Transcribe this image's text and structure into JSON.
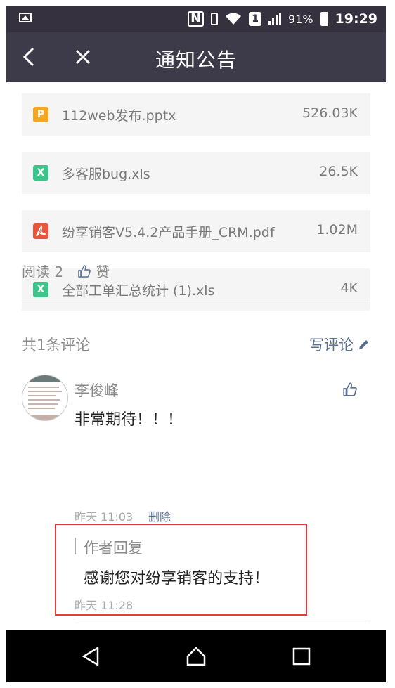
{
  "status_bar": {
    "sim": "1",
    "battery_percent": "91%",
    "time": "19:29",
    "icons": [
      "image-icon",
      "nfc-icon",
      "vibrate-icon",
      "wifi-icon",
      "sim-icon",
      "signal-icon",
      "battery-icon"
    ]
  },
  "header": {
    "title": "通知公告",
    "back_icon": "chevron-left-icon",
    "close_icon": "close-icon"
  },
  "attachments": [
    {
      "type": "P",
      "name": "112web发布.pptx",
      "size": "526.03K",
      "color": "#f5a623"
    },
    {
      "type": "X",
      "name": "多客服bug.xls",
      "size": "26.5K",
      "color": "#3cc48a"
    },
    {
      "type": "pdf",
      "name": "纷享销客V5.4.2产品手册_CRM.pdf",
      "size": "1.02M",
      "color": "#e8573c"
    },
    {
      "type": "X",
      "name": "全部工单汇总统计 (1).xls",
      "size": "4K",
      "color": "#3cc48a"
    }
  ],
  "stats": {
    "reads": "阅读 2",
    "like_label": "赞"
  },
  "comments_header": {
    "count": "共1条评论",
    "write": "写评论"
  },
  "comment": {
    "name": "李俊峰",
    "text": "非常期待！！！",
    "time": "昨天 11:03",
    "delete": "删除"
  },
  "reply": {
    "label": "作者回复",
    "text": "感谢您对纷享销客的支持！",
    "time": "昨天 11:28"
  },
  "colors": {
    "status_bar": "#35313f",
    "title_bar": "#3d3a49",
    "link": "#5a6f90",
    "highlight": "#e23b3b"
  }
}
